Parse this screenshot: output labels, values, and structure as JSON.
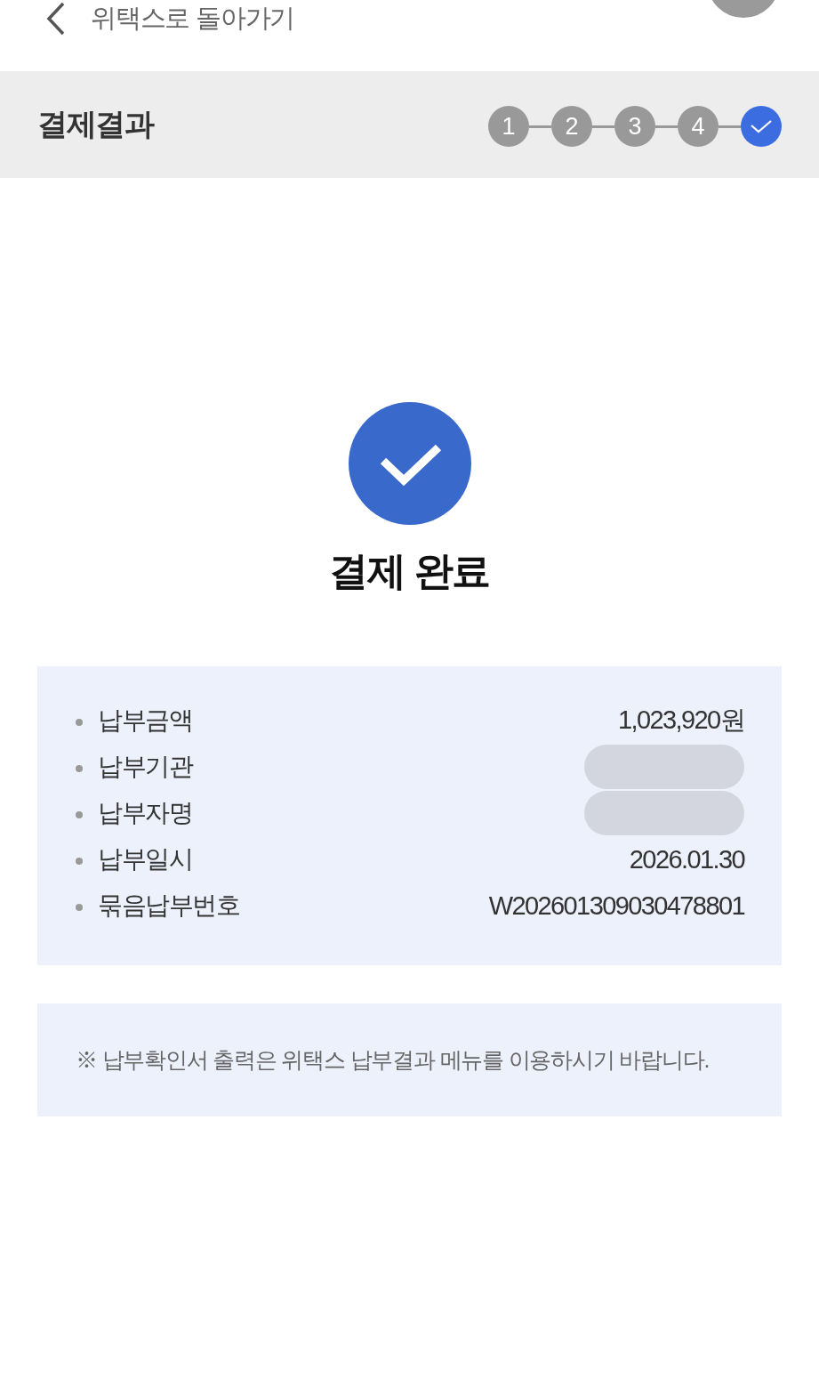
{
  "header": {
    "back_label": "위택스로 돌아가기"
  },
  "title": "결제결과",
  "steps": [
    {
      "kind": "number",
      "label": "1",
      "selected": false
    },
    {
      "kind": "number",
      "label": "2",
      "selected": false
    },
    {
      "kind": "number",
      "label": "3",
      "selected": false
    },
    {
      "kind": "number",
      "label": "4",
      "selected": false
    },
    {
      "kind": "check",
      "selected": true
    }
  ],
  "result": {
    "title": "결제 완료"
  },
  "info": {
    "rows": [
      {
        "label": "납부금액",
        "value": "1,023,920원"
      },
      {
        "label": "납부기관",
        "redacted": true
      },
      {
        "label": "납부자명",
        "redacted": true
      },
      {
        "label": "납부일시",
        "value": "2026.01.30"
      },
      {
        "label": "묶음납부번호",
        "value": "W202601309030478801"
      }
    ]
  },
  "note": "※ 납부확인서 출력은 위택스 납부결과 메뉴를 이용하시기 바랍니다."
}
